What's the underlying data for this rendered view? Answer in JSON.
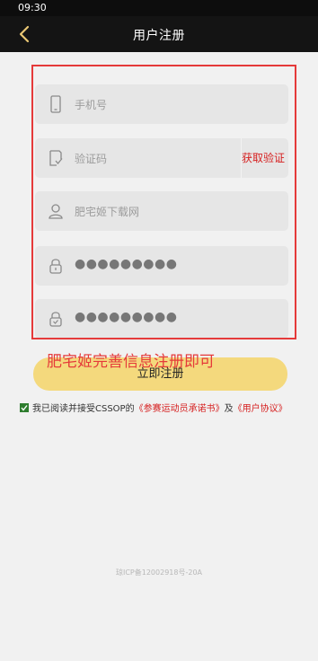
{
  "status": {
    "time": "09:30"
  },
  "header": {
    "title": "用户注册"
  },
  "form": {
    "phone_placeholder": "手机号",
    "code_placeholder": "验证码",
    "get_code_label": "获取验证码",
    "invite_placeholder": "肥宅姬下载网",
    "password_mask": "●●●●●●●●●",
    "confirm_mask": "●●●●●●●●●"
  },
  "register_button": {
    "label": "立即注册"
  },
  "annotation": {
    "text": "肥宅姬完善信息注册即可"
  },
  "agreement": {
    "prefix": "我已阅读并接受CSSOP的",
    "link1": "《参赛运动员承诺书》",
    "and": "及",
    "link2": "《用户协议》"
  },
  "footer": {
    "icp": "琼ICP备12002918号-20A"
  },
  "colors": {
    "accent": "#d61f1f",
    "button": "#f4d97d",
    "header_bg": "#141414"
  }
}
